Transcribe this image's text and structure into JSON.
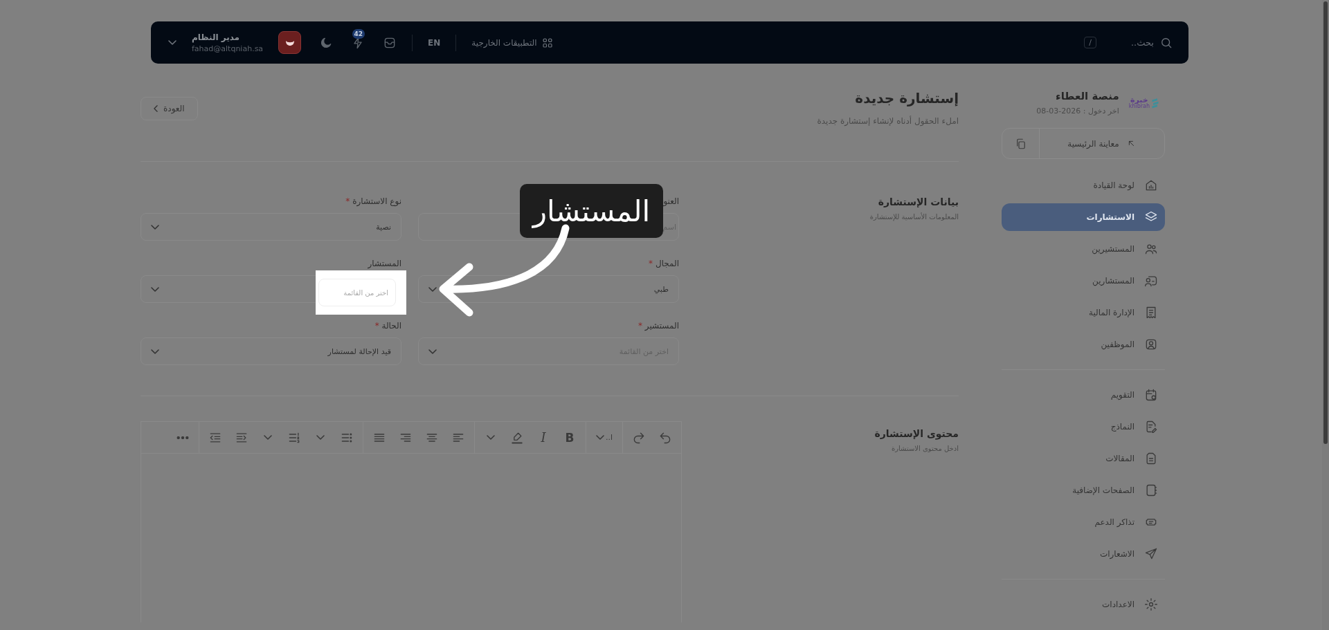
{
  "topbar": {
    "search": {
      "placeholder": "بحث..",
      "shortcut": "/"
    },
    "external_apps": "التطبيقات الخارجية",
    "language": "EN",
    "notifications_badge": "42",
    "user": {
      "name": "مدير النظام",
      "email": "fahad@altqniah.sa"
    }
  },
  "sidebar": {
    "logo": {
      "text": "خبرة",
      "subtext": "khibrah"
    },
    "title": "منصة العطاء",
    "last_login": "اخر دخول : 2026-03-08",
    "preview": "معاينة الرئيسية",
    "groups": [
      [
        {
          "label": "لوحة القيادة",
          "selected": false
        },
        {
          "label": "الاستشارات",
          "selected": true
        },
        {
          "label": "المستشيرين",
          "selected": false
        },
        {
          "label": "المستشارين",
          "selected": false
        },
        {
          "label": "الإدارة المالية",
          "selected": false
        },
        {
          "label": "الموظفين",
          "selected": false
        }
      ],
      [
        {
          "label": "التقويم",
          "selected": false
        },
        {
          "label": "النماذج",
          "selected": false
        },
        {
          "label": "المقالات",
          "selected": false
        },
        {
          "label": "الصفحات الإضافية",
          "selected": false
        },
        {
          "label": "تذاكر الدعم",
          "selected": false
        },
        {
          "label": "الاشعارات",
          "selected": false
        }
      ],
      [
        {
          "label": "الاعدادات",
          "selected": false
        }
      ]
    ]
  },
  "page": {
    "title": "إستشارة جديدة",
    "subtitle": "املء الحقول أدناه لإنشاء إستشارة جديدة",
    "back": "العودة"
  },
  "details": {
    "title": "بيانات الإستشارة",
    "subtitle": "المعلومات الأساسية للإستشارة",
    "fields": [
      {
        "kind": "text",
        "label": "العنو",
        "placeholder": "اسم"
      },
      {
        "kind": "select",
        "label": "نوع الاستشارة",
        "mark": "*",
        "value": "نصية"
      },
      {
        "kind": "select",
        "label": "المجال",
        "mark": "*",
        "value": "طبي"
      },
      {
        "kind": "select",
        "label": "المستشار"
      },
      {
        "kind": "select",
        "label": "المستشير",
        "mark": "*",
        "placeholder": "اختر من القائمة"
      },
      {
        "kind": "select",
        "label": "الحالة",
        "mark": "*",
        "value": "قيد الإحالة لمستشار"
      }
    ]
  },
  "content": {
    "title": "محتوى الإستشارة",
    "subtitle": "ادخل محتوى الاستشارة",
    "toolbar": [
      [
        {
          "kind": "undo"
        },
        {
          "kind": "redo"
        }
      ],
      [
        {
          "kind": "font-size",
          "label": "ا.."
        }
      ],
      [
        {
          "kind": "bold",
          "label": "B"
        },
        {
          "kind": "italic",
          "label": "I"
        },
        {
          "kind": "highlight"
        },
        {
          "kind": "caret"
        }
      ],
      [
        {
          "kind": "align-left"
        },
        {
          "kind": "align-center"
        },
        {
          "kind": "align-right"
        },
        {
          "kind": "justify"
        }
      ],
      [
        {
          "kind": "bullet-list"
        },
        {
          "kind": "caret"
        },
        {
          "kind": "numbered-list"
        },
        {
          "kind": "caret"
        },
        {
          "kind": "indent"
        },
        {
          "kind": "outdent"
        }
      ],
      [
        {
          "kind": "more"
        }
      ]
    ]
  },
  "tour": {
    "tooltip": "المستشار",
    "target": {
      "placeholder": "اختر من القائمة"
    }
  }
}
